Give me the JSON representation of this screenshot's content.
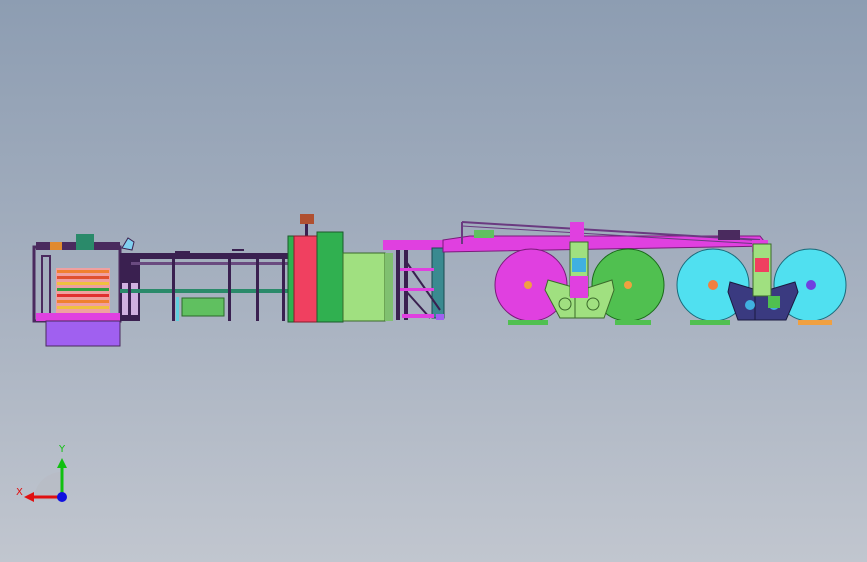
{
  "viewport": {
    "background_top": "#8d9db2",
    "background_bottom": "#c1c6cf"
  },
  "model": {
    "description_colors": {
      "magenta_frame": "#e040e0",
      "dark_purple": "#4a2a5e",
      "red_unit": "#f04060",
      "green_unit": "#30b050",
      "light_green": "#a0e080",
      "teal": "#3a8a90",
      "magenta_roll": "#e040e0",
      "green_roll": "#50c050",
      "cyan_roll": "#50e0f0",
      "violet_box": "#a060f0"
    }
  },
  "triad": {
    "x_label": "X",
    "y_label": "Y",
    "x_color": "#e01010",
    "y_color": "#10c010",
    "z_color": "#1010e0"
  }
}
